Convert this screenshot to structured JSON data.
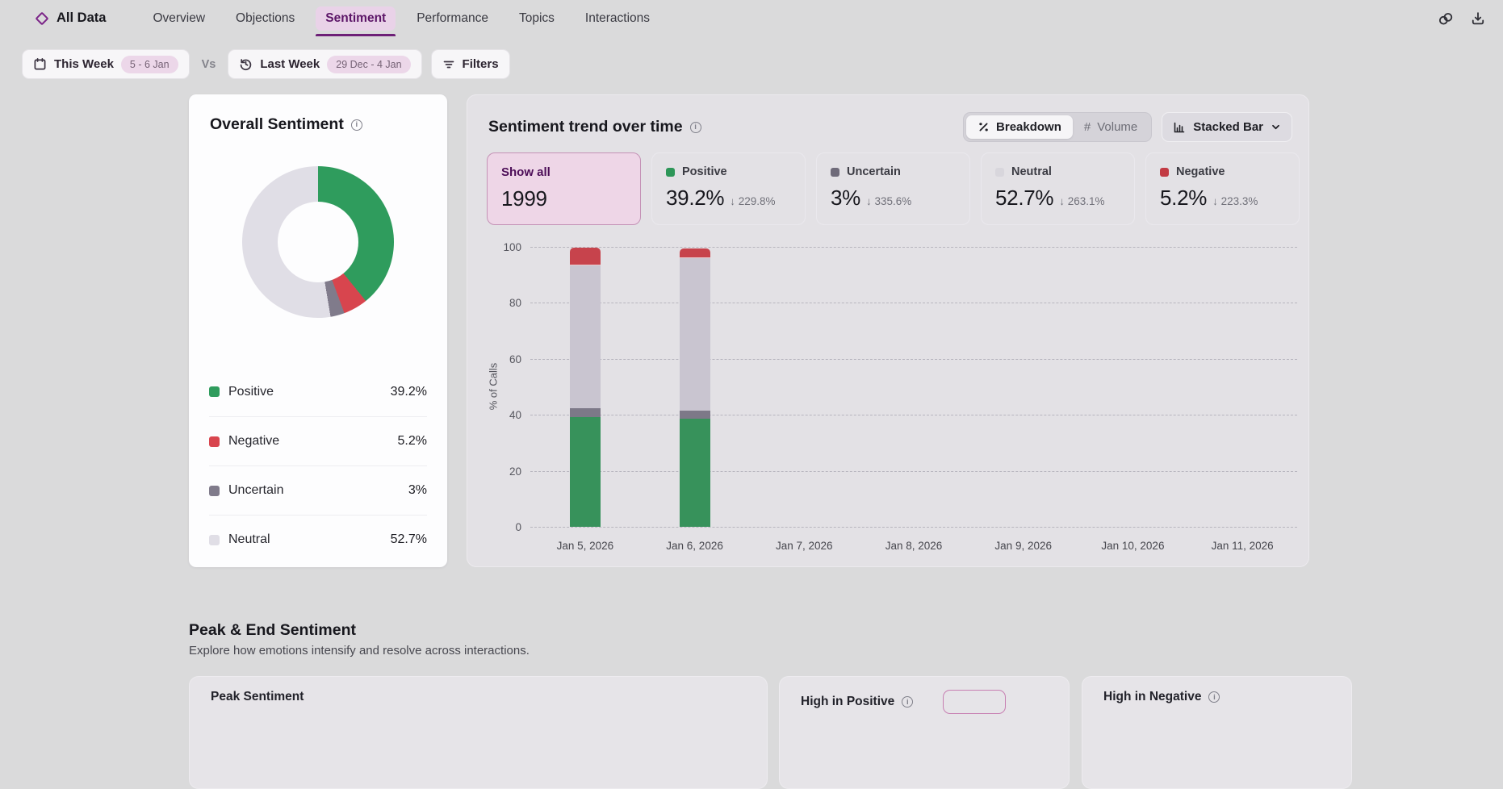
{
  "nav": {
    "app_name": "All Data",
    "tabs": [
      {
        "label": "Overview"
      },
      {
        "label": "Objections"
      },
      {
        "label": "Sentiment"
      },
      {
        "label": "Performance"
      },
      {
        "label": "Topics"
      },
      {
        "label": "Interactions"
      }
    ],
    "active_tab": "Sentiment"
  },
  "filters": {
    "this_week": {
      "label": "This Week",
      "range": "5 - 6 Jan"
    },
    "vs": "Vs",
    "last_week": {
      "label": "Last Week",
      "range": "29 Dec - 4 Jan"
    },
    "filters_label": "Filters"
  },
  "overall": {
    "title": "Overall Sentiment",
    "legend": [
      {
        "label": "Positive",
        "value": "39.2%",
        "color": "#2f9c5d"
      },
      {
        "label": "Negative",
        "value": "5.2%",
        "color": "#d8454e"
      },
      {
        "label": "Uncertain",
        "value": "3%",
        "color": "#807b8b"
      },
      {
        "label": "Neutral",
        "value": "52.7%",
        "color": "#e0dee6"
      }
    ]
  },
  "trend": {
    "title": "Sentiment trend over time",
    "toggle": {
      "breakdown": "Breakdown",
      "volume": "Volume"
    },
    "chart_type": "Stacked Bar",
    "cards": [
      {
        "label": "Show all",
        "value": "1999"
      },
      {
        "label": "Positive",
        "value": "39.2%",
        "delta": "↓ 229.8%",
        "color": "#2d9658"
      },
      {
        "label": "Uncertain",
        "value": "3%",
        "delta": "↓ 335.6%",
        "color": "#6f6b7a"
      },
      {
        "label": "Neutral",
        "value": "52.7%",
        "delta": "↓ 263.1%",
        "color": "#d8d6dc"
      },
      {
        "label": "Negative",
        "value": "5.2%",
        "delta": "↓ 223.3%",
        "color": "#c23b44"
      }
    ]
  },
  "peak_end": {
    "title": "Peak & End Sentiment",
    "subtitle": "Explore how emotions intensify and resolve across interactions.",
    "cards": [
      {
        "title": "Peak Sentiment"
      },
      {
        "title": "High in Positive"
      },
      {
        "title": "High in Negative"
      }
    ]
  },
  "chart_data": [
    {
      "type": "pie",
      "donut": true,
      "title": "Overall Sentiment",
      "labels": [
        "Positive",
        "Negative",
        "Uncertain",
        "Neutral"
      ],
      "values": [
        39.2,
        5.2,
        3,
        52.7
      ],
      "colors": [
        "#2f9c5d",
        "#d8454e",
        "#807b8b",
        "#e0dee6"
      ],
      "legend_position": "bottom"
    },
    {
      "type": "bar",
      "stacked": true,
      "title": "Sentiment trend over time",
      "categories": [
        "Jan 5, 2026",
        "Jan 6, 2026",
        "Jan 7, 2026",
        "Jan 8, 2026",
        "Jan 9, 2026",
        "Jan 10, 2026",
        "Jan 11, 2026"
      ],
      "series": [
        {
          "name": "Positive",
          "color": "#37925b",
          "values": [
            39.2,
            38.6,
            0,
            0,
            0,
            0,
            0
          ]
        },
        {
          "name": "Uncertain",
          "color": "#7d7988",
          "values": [
            3.1,
            3.0,
            0,
            0,
            0,
            0,
            0
          ]
        },
        {
          "name": "Neutral",
          "color": "#c9c5d0",
          "values": [
            51.0,
            54.3,
            0,
            0,
            0,
            0,
            0
          ]
        },
        {
          "name": "Negative",
          "color": "#c7434c",
          "values": [
            6.5,
            3.5,
            0,
            0,
            0,
            0,
            0
          ]
        }
      ],
      "xlabel": "",
      "ylabel": "% of Calls",
      "ylim": [
        0,
        100
      ],
      "yticks": [
        0,
        20,
        40,
        60,
        80,
        100
      ],
      "grid": "dashed-horizontal"
    }
  ]
}
